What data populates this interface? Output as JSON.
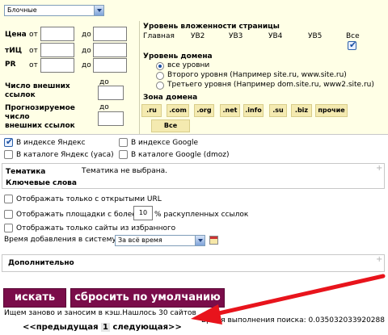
{
  "top": {
    "category_select": "Блочные"
  },
  "filters": {
    "price_label": "Цена",
    "tic_label": "тИЦ",
    "pr_label": "PR",
    "from": "от",
    "to": "до",
    "ext_links_label_1": "Число внешних",
    "ext_links_label_2": "ссылок",
    "forecast_label_1": "Прогнозируемое",
    "forecast_label_2": "число",
    "forecast_label_3": "внешних ссылок"
  },
  "nesting": {
    "title": "Уровень вложенности страницы",
    "levels": [
      "Главная",
      "УВ2",
      "УВ3",
      "УВ4",
      "УВ5",
      "Все"
    ]
  },
  "domain_level": {
    "title": "Уровень домена",
    "options": [
      "все уровни",
      "Второго уровня (Например site.ru, www.site.ru)",
      "Третьего уровня (Например dom.site.ru, www2.site.ru)"
    ]
  },
  "zone": {
    "title": "Зона домена",
    "items": [
      ".ru",
      ".com",
      ".org",
      ".net",
      ".info",
      ".su",
      ".biz",
      "прочие"
    ],
    "all_label": "Все"
  },
  "index": {
    "yandex": "В индексе Яндекс",
    "google": "В индексе Google",
    "yaca": "В каталоге Яндекс (yaca)",
    "dmoz": "В каталоге Google (dmoz)"
  },
  "thematics": {
    "label": "Тематика",
    "value": "Тематика не выбрана.",
    "keywords_label": "Ключевые слова"
  },
  "options": {
    "open_url": "Отображать только с открытыми URL",
    "show_more_prefix": "Отображать площадки с более",
    "show_more_value": "10",
    "show_more_suffix": "% раскупленных ссылок",
    "favorites": "Отображать только сайты из избранного",
    "added_time_label": "Время добавления в систему",
    "added_time_value": "За всё время"
  },
  "extra": {
    "label": "Дополнительно"
  },
  "actions": {
    "search": "искать",
    "reset": "сбросить по умолчанию"
  },
  "status": {
    "result": "Ищем заново и заносим в кэш.Нашлось 30 сайтов",
    "exec_time": "Время выполнения поиска: 0.035032033920288"
  },
  "pagination": {
    "prev": "<<предыдущая",
    "page": "1",
    "next": "следующая>>"
  },
  "colors": {
    "panel": "#ffffe6",
    "zone_button": "#f4eab0",
    "action_button": "#7a0d4a",
    "annotation_arrow": "#e8141c"
  }
}
